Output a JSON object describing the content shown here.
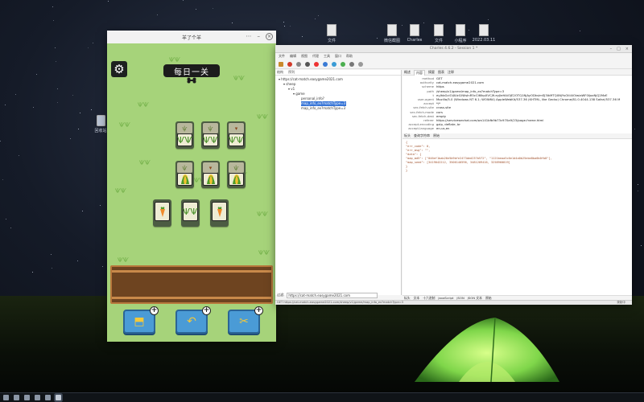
{
  "desktop": {
    "icons_top": [
      {
        "label": "文件"
      },
      {
        "label": "微信截图"
      },
      {
        "label": "Charles"
      },
      {
        "label": "文件"
      },
      {
        "label": "小程序"
      },
      {
        "label": "2022.03.11"
      }
    ],
    "icon_left": {
      "label": "回收站"
    }
  },
  "game": {
    "window_title": "羊了个羊",
    "banner": "每日一关",
    "tiles": [
      {
        "row": 1,
        "items": [
          "grass-icon",
          "grass-icon",
          "grass-icon"
        ]
      },
      {
        "row": 2,
        "items": [
          "corn-icon",
          "corn-icon",
          "corn-icon"
        ]
      },
      {
        "row": 3,
        "items": [
          "carrot-icon",
          "grass-icon",
          "carrot-icon"
        ]
      }
    ],
    "tools": [
      {
        "name": "move-out",
        "icon": "shirt-icon"
      },
      {
        "name": "undo",
        "icon": "undo-icon"
      },
      {
        "name": "shuffle",
        "icon": "shuffle-icon"
      }
    ]
  },
  "charles": {
    "title": "Charles 4.6.2 - Session 1 *",
    "menu": [
      "文件",
      "编辑",
      "视图",
      "代理",
      "工具",
      "窗口",
      "帮助"
    ],
    "left_header": [
      "结构",
      "序列"
    ],
    "tree": [
      "https://cat-match.easygame2021.com",
      "sheep",
      "v1",
      "game",
      "personal_info?",
      "map_info_ex?matchType=3",
      "map_info_ex?matchType=3"
    ],
    "filter_label": "过滤:",
    "filter_value": "https://cat-match.easygame2021.com",
    "right_tabs": [
      "概述",
      "内容",
      "摘要",
      "图表",
      "注释"
    ],
    "headers": [
      {
        "k": "method",
        "v": "GET"
      },
      {
        "k": "authority",
        "v": "cat-match.easygame2021.com"
      },
      {
        "k": "scheme",
        "v": "https"
      },
      {
        "k": "path",
        "v": "/sheep/v1/game/map_info_ex?matchType=3"
      },
      {
        "k": "t",
        "v": "eyJhbGciOiJIUzI1NiIsInR5cCI6IkpXVCJ9.eyJleHAiOjE2OTQ1NjAyODkslmSJ3IkMTQ0NjYsOiIi4iOiwiaWF0IjoxNjQ2MzE"
      },
      {
        "k": "user-agent",
        "v": "Mozilla/5.0 (Windows NT 6.1; WOW64) AppleWebKit/537.36 (KHTML, like Gecko) Chrome/81.0.4044.138 Safari/537.36 M"
      },
      {
        "k": "accept",
        "v": "*/*"
      },
      {
        "k": "sec-fetch-site",
        "v": "cross-site"
      },
      {
        "k": "sec-fetch-mode",
        "v": "cors"
      },
      {
        "k": "sec-fetch-dest",
        "v": "empty"
      },
      {
        "k": "referer",
        "v": "https://servicewechat.com/wx141bfb9b73c970a9/23/page-frame.html"
      },
      {
        "k": "accept-encoding",
        "v": "gzip, deflate, br"
      },
      {
        "k": "accept-language",
        "v": "en-us,en"
      }
    ],
    "lower_tabs": [
      "标头",
      "查询字符串",
      "原始"
    ],
    "json_lines": [
      "{",
      "  \"err_code\": 0,",
      "  \"err_msg\": \"\",",
      "  \"data\": {",
      "    \"map_md5\": [\"046ef1bab26e5b9bfe2473ded237b572\", \"1121beaa5c0e1d4a0b25ebe8ba0b0fb8\"],",
      "    \"map_seed\": [3419042212, 3506140596, 3481209416, 3258960819]",
      "  }",
      "}"
    ],
    "bottom_tabs": [
      "标头",
      "文本",
      "十六进制",
      "JavaScript",
      "JSON",
      "JSON 文本",
      "原始"
    ],
    "status_left": "GET https://cat-match.easygame2021.com/sheep/v1/game/map_info_ex?matchType=3",
    "status_right": "录制中"
  },
  "colors": {
    "game_bg": "#a6d37a",
    "tool_blue": "#4a9bd6",
    "slot_wood": "#6e4420",
    "tent_green": "#7fd64a"
  }
}
